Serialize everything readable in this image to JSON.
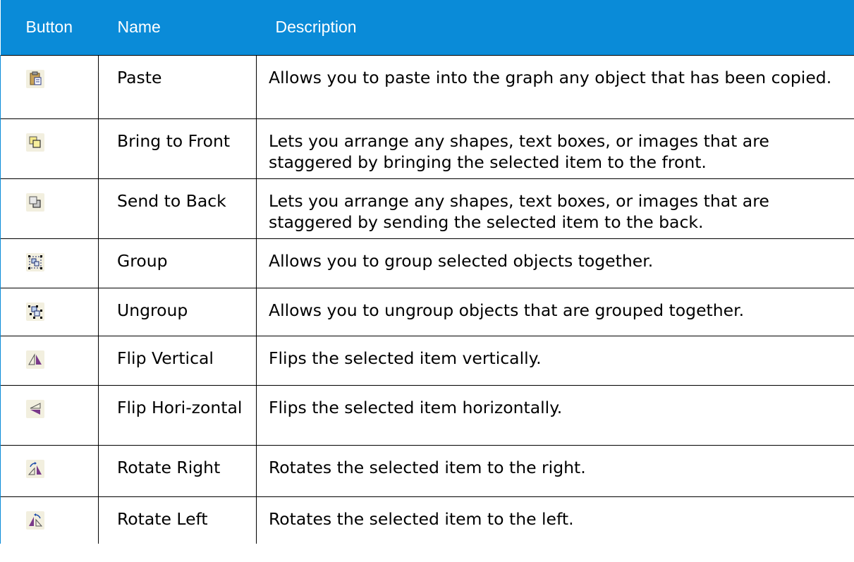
{
  "header": {
    "col_button": "Button",
    "col_name": "Name",
    "col_description": "Description"
  },
  "rows": [
    {
      "icon": "paste-icon",
      "name": "Paste",
      "description": "Allows you to paste into the graph any object that has been copied."
    },
    {
      "icon": "bring-to-front-icon",
      "name": "Bring to Front",
      "description": "Lets you arrange any shapes, text boxes, or images that are staggered by bringing the selected item to the front."
    },
    {
      "icon": "send-to-back-icon",
      "name": "Send to Back",
      "description": "Lets you arrange any shapes, text boxes, or images that are staggered by sending the selected item to the back."
    },
    {
      "icon": "group-icon",
      "name": "Group",
      "description": "Allows you to group selected objects together."
    },
    {
      "icon": "ungroup-icon",
      "name": "Ungroup",
      "description": "Allows you to ungroup objects that are grouped together."
    },
    {
      "icon": "flip-vertical-icon",
      "name": "Flip Vertical",
      "description": "Flips the selected item vertically."
    },
    {
      "icon": "flip-horizontal-icon",
      "name": "Flip Hori-zontal",
      "description": "Flips the selected item horizontally."
    },
    {
      "icon": "rotate-right-icon",
      "name": "Rotate Right",
      "description": "Rotates the selected item to the right."
    },
    {
      "icon": "rotate-left-icon",
      "name": "Rotate Left",
      "description": "Rotates the selected item to the left."
    }
  ],
  "colors": {
    "header_bg": "#0a8bd8",
    "header_text": "#ffffff",
    "border": "#000000"
  }
}
